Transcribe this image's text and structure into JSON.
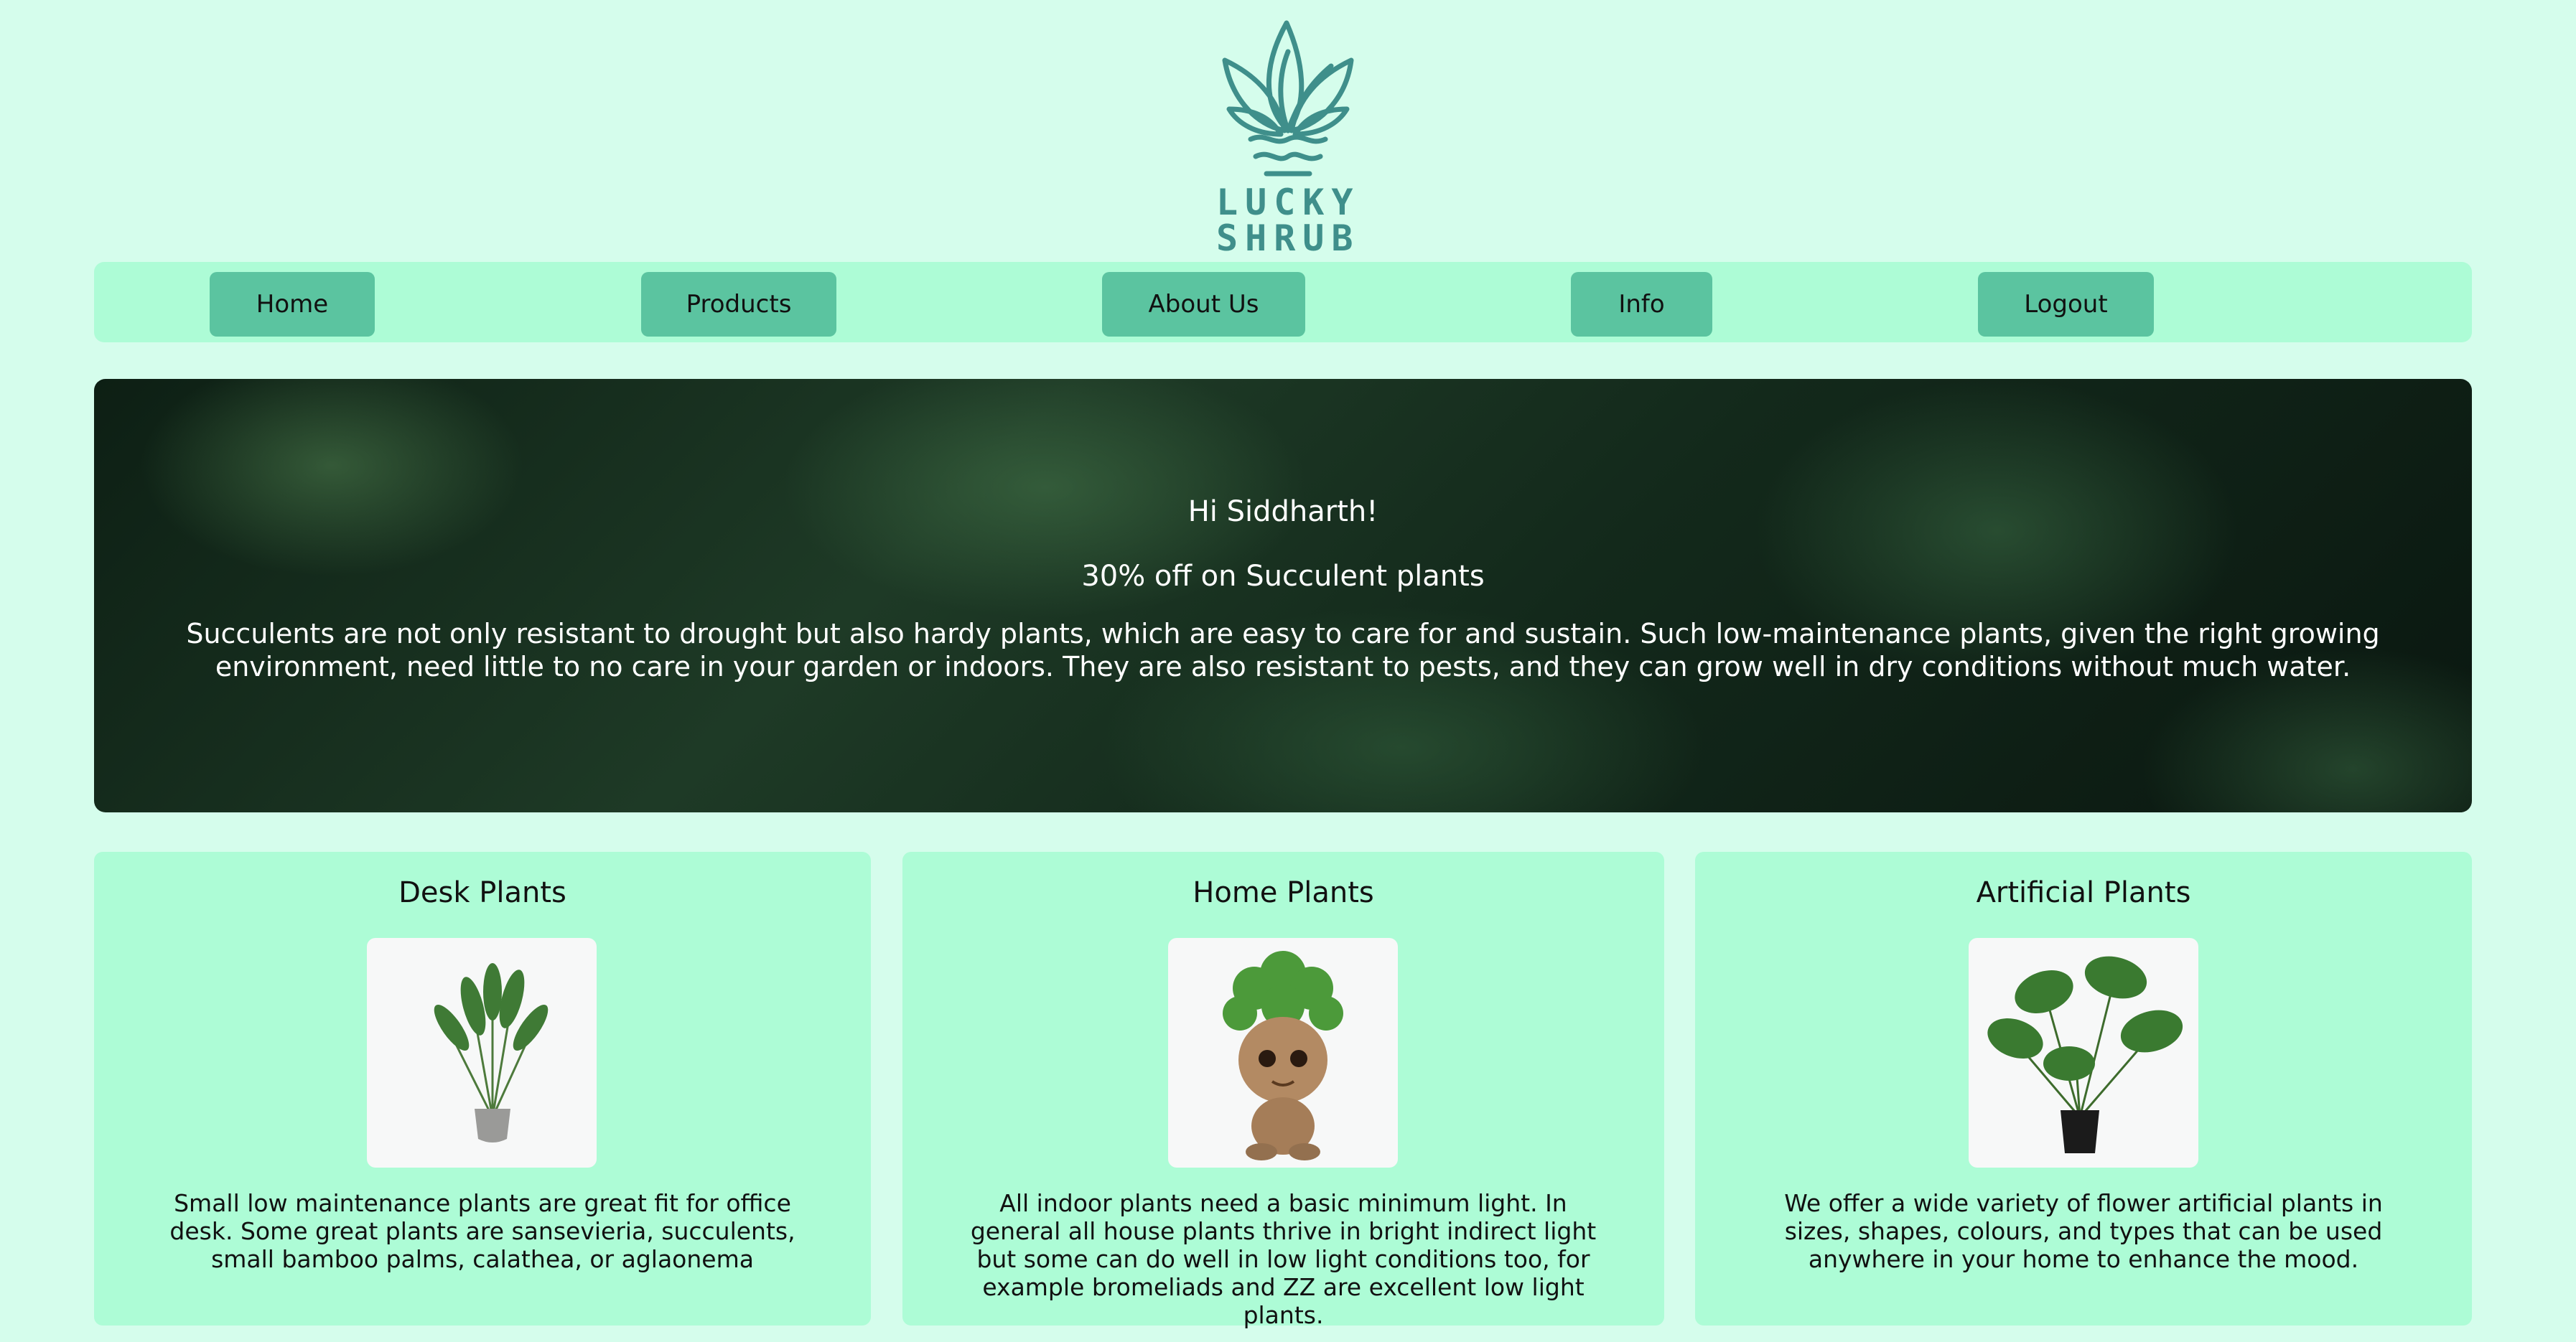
{
  "logo": {
    "icon": "plant-logo-icon",
    "line1": "LUCKY",
    "line2": "SHRUB"
  },
  "nav": {
    "items": [
      {
        "label": "Home"
      },
      {
        "label": "Products"
      },
      {
        "label": "About Us"
      },
      {
        "label": "Info"
      },
      {
        "label": "Logout"
      }
    ]
  },
  "banner": {
    "greeting": "Hi Siddharth!",
    "offer": "30% off on Succulent plants",
    "description": "Succulents are not only resistant to drought but also hardy plants, which are easy to care for and sustain. Such low-maintenance plants, given the right growing environment, need little to no care in your garden or indoors. They are also resistant to pests, and they can grow well in dry conditions without much water."
  },
  "cards": [
    {
      "title": "Desk Plants",
      "description": "Small low maintenance plants are great fit for office desk. Some great plants are sansevieria, succulents, small bamboo palms, calathea, or aglaonema"
    },
    {
      "title": "Home Plants",
      "description": "All indoor plants need a basic minimum light. In general all house plants thrive in bright indirect light but some can do well in low light conditions too, for example bromeliads and ZZ are excellent low light plants."
    },
    {
      "title": "Artificial Plants",
      "description": "We offer a wide variety of flower artificial plants in sizes, shapes, colours, and types that can be used anywhere in your home to enhance the mood."
    }
  ],
  "colors": {
    "page_bg": "#d5fdec",
    "panel_bg": "#adfcd6",
    "button_bg": "#5bc4a0",
    "logo": "#3f8f8b"
  }
}
